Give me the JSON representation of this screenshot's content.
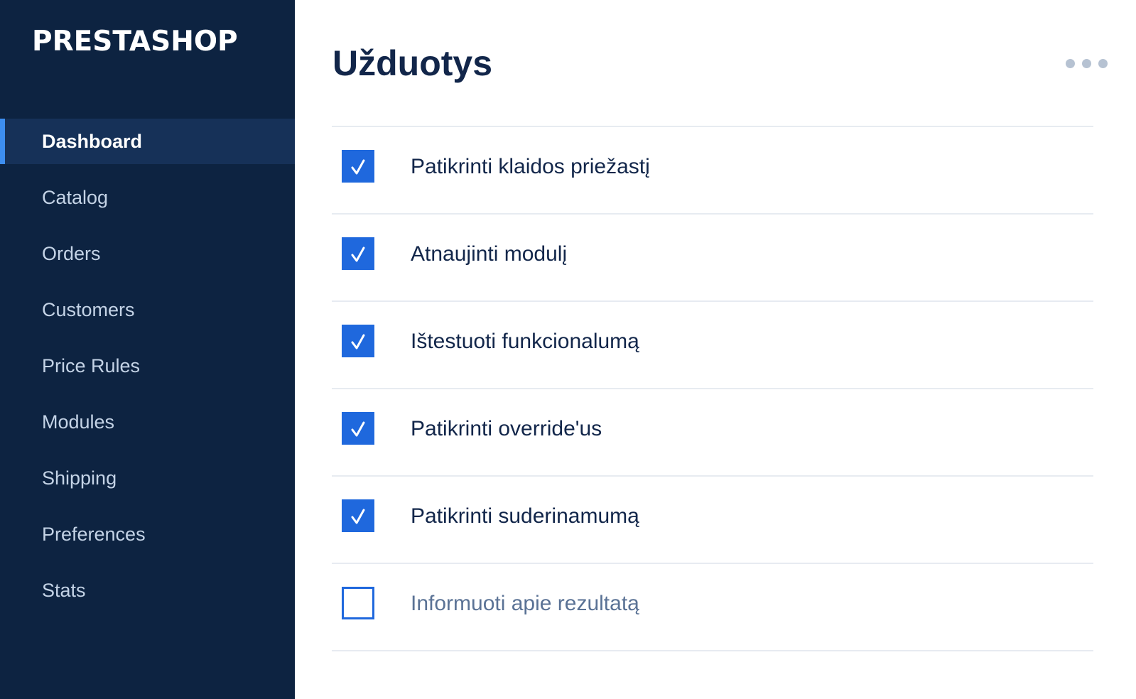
{
  "brand": {
    "logo_text": "PRESTASHOP"
  },
  "sidebar": {
    "items": [
      {
        "label": "Dashboard",
        "active": true
      },
      {
        "label": "Catalog",
        "active": false
      },
      {
        "label": "Orders",
        "active": false
      },
      {
        "label": "Customers",
        "active": false
      },
      {
        "label": "Price Rules",
        "active": false
      },
      {
        "label": "Modules",
        "active": false
      },
      {
        "label": "Shipping",
        "active": false
      },
      {
        "label": "Preferences",
        "active": false
      },
      {
        "label": "Stats",
        "active": false
      }
    ]
  },
  "main": {
    "title": "Užduotys",
    "more_menu_icon": "more-horizontal-icon",
    "tasks": [
      {
        "label": "Patikrinti klaidos priežastį",
        "checked": true
      },
      {
        "label": "Atnaujinti modulį",
        "checked": true
      },
      {
        "label": "Ištestuoti funkcionalumą",
        "checked": true
      },
      {
        "label": "Patikrinti override'us",
        "checked": true
      },
      {
        "label": "Patikrinti suderinamumą",
        "checked": true
      },
      {
        "label": "Informuoti apie rezultatą",
        "checked": false
      }
    ]
  },
  "colors": {
    "sidebar_bg": "#0d2341",
    "sidebar_active_bg": "#163158",
    "accent": "#3d8ef0",
    "checkbox": "#1f68dd",
    "title": "#12264a",
    "pending_text": "#5a7295"
  }
}
